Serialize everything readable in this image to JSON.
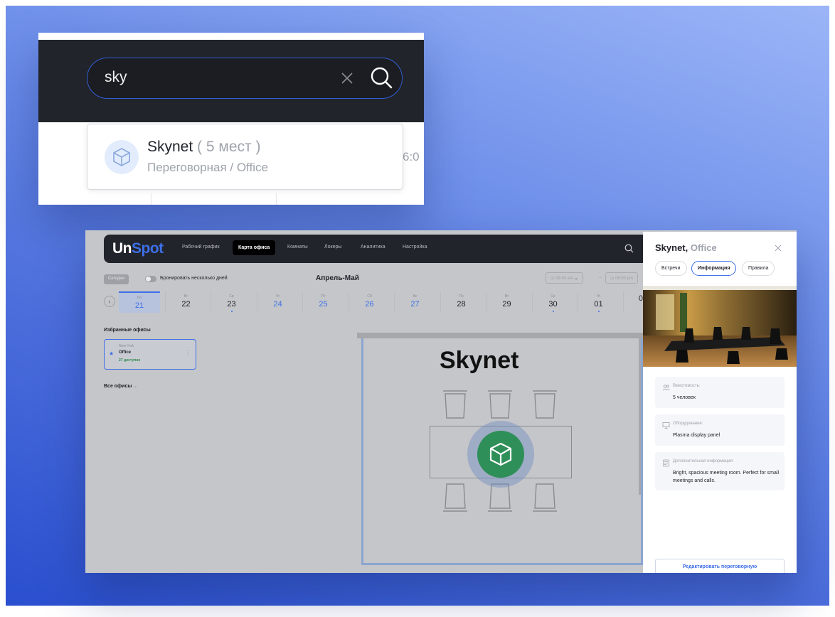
{
  "search": {
    "query": "sky",
    "result": {
      "name": "Skynet",
      "capacity": " ( 5 мест )",
      "subtitle": "Переговорная / Office"
    },
    "partial_time": "6:0"
  },
  "app": {
    "logo_un": "Un",
    "logo_spot": "Spot",
    "nav": [
      "Рабочий график",
      "Карта офиса",
      "Комнаты",
      "Локеры",
      "Аналитика",
      "Настройка"
    ],
    "today_label": "Сегодня",
    "multiday_label": "Бронировать несколько дней",
    "month_title": "Апрель-Май",
    "time_from": "09:40 am",
    "time_to": "06:00 pm",
    "time_dash": "–",
    "prev_arrow": "‹",
    "days": [
      {
        "name": "Пн",
        "date": "21"
      },
      {
        "name": "Вт",
        "date": "22"
      },
      {
        "name": "Ср",
        "date": "23"
      },
      {
        "name": "Чт",
        "date": "24"
      },
      {
        "name": "Пт",
        "date": "25"
      },
      {
        "name": "Сб",
        "date": "26"
      },
      {
        "name": "Вс",
        "date": "27"
      },
      {
        "name": "Пн",
        "date": "28"
      },
      {
        "name": "Вт",
        "date": "29"
      },
      {
        "name": "Ср",
        "date": "30"
      },
      {
        "name": "Чт",
        "date": "01"
      },
      {
        "name": "",
        "date": "0"
      }
    ],
    "favorites_title": "Избранные офисы",
    "favorite": {
      "city": "New York",
      "office": "Office",
      "available": "27 доступно"
    },
    "all_offices": "Все офисы",
    "floor_room_title": "Skynet",
    "accent_color": "#3d6fe8",
    "pin_color": "#2f8f58"
  },
  "panel": {
    "title": "Skynet,",
    "title_muted": " Office",
    "tabs": [
      "Встречи",
      "Информация",
      "Правила"
    ],
    "capacity_label": "Вместимость:",
    "capacity_value": "5 человек",
    "equipment_label": "Оборудование:",
    "equipment_value": "Plasma display panel",
    "extra_label": "Дополнительная информация:",
    "extra_value": "Bright, spacious meeting room. Perfect for small meetings and calls.",
    "edit_button": "Редактировать переговорную"
  }
}
